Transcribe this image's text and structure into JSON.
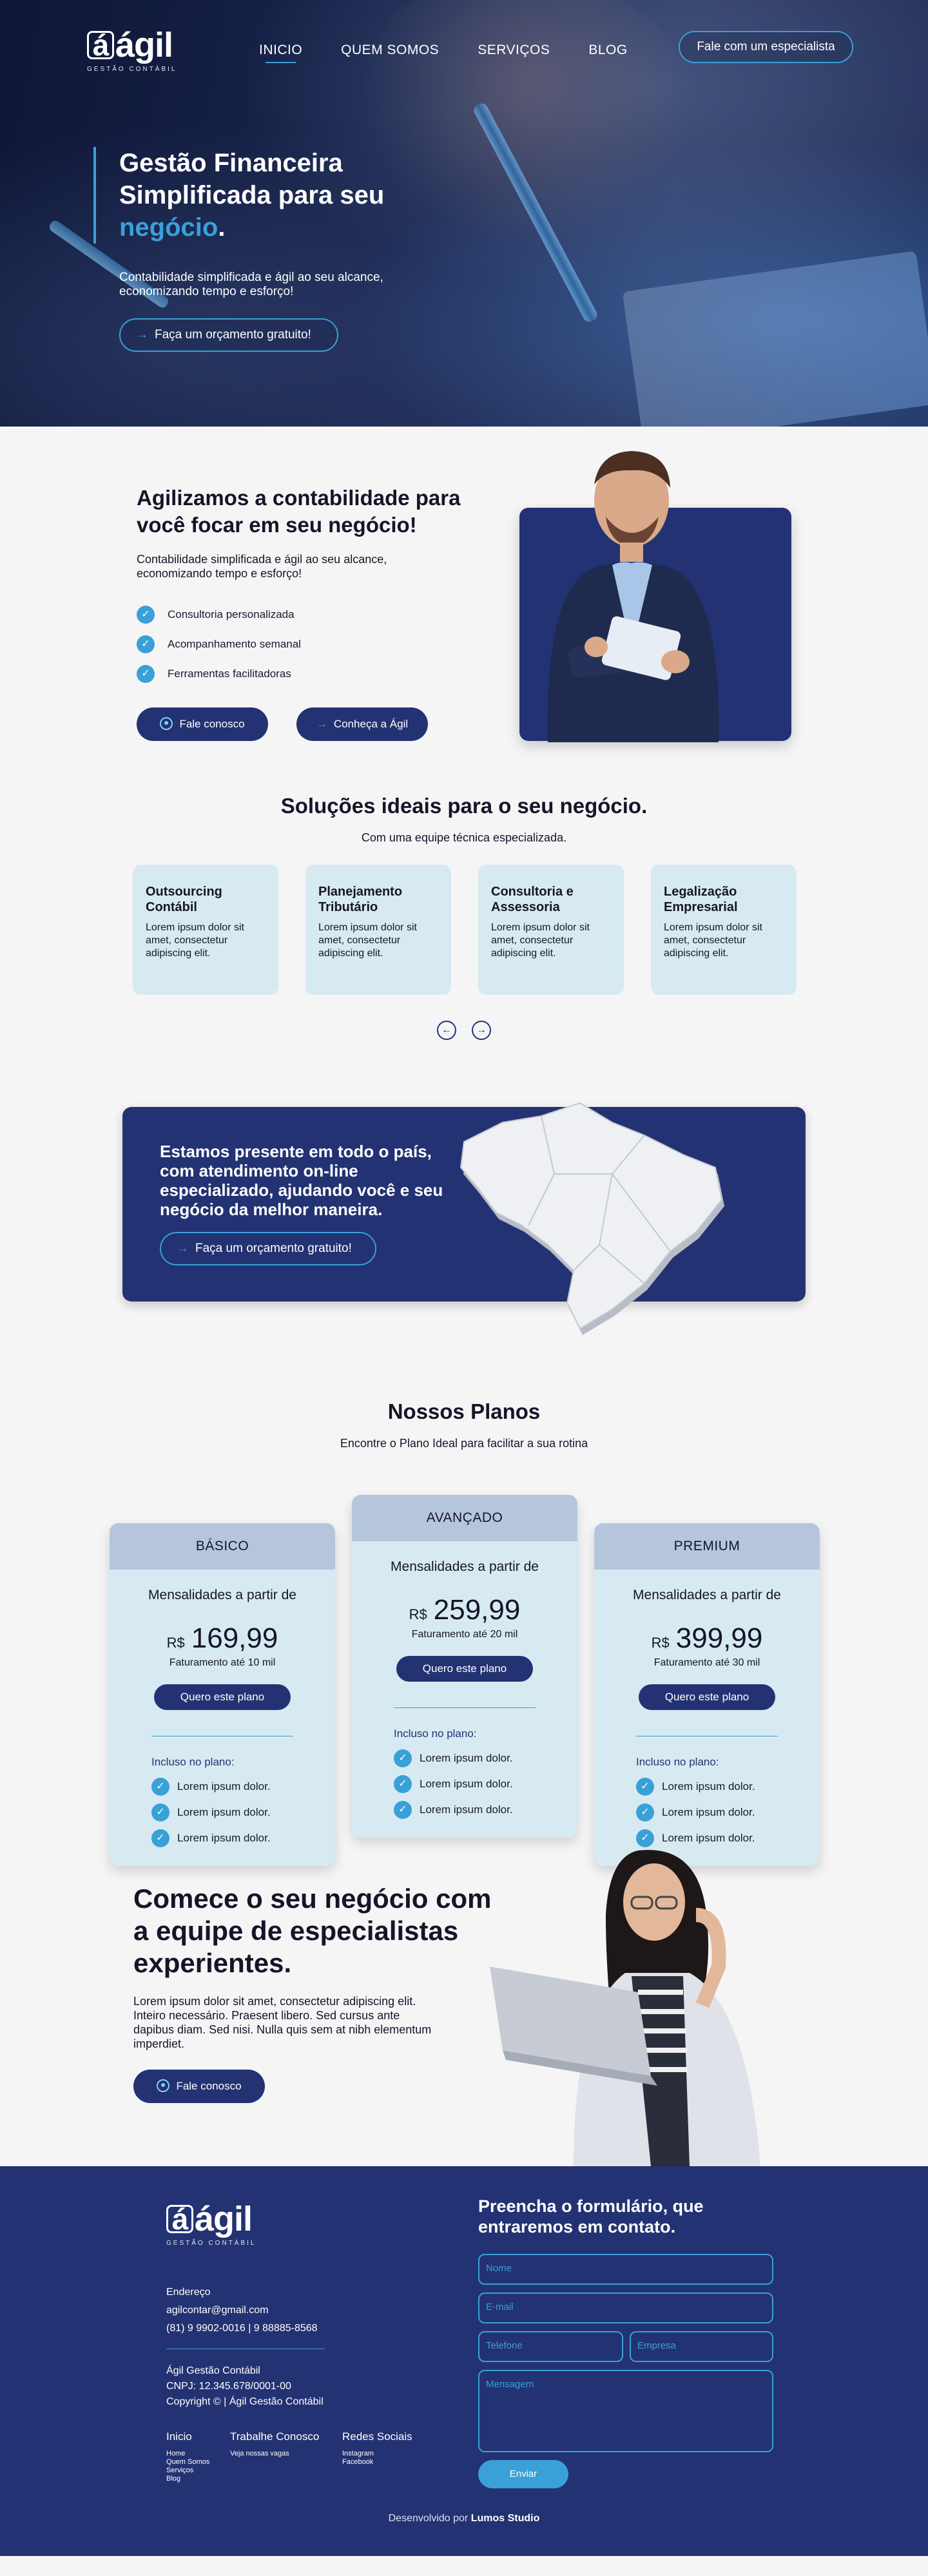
{
  "header": {
    "logo_text": "ágil",
    "logo_sub": "GESTÃO CONTÁBIL",
    "menu": [
      "INICIO",
      "QUEM SOMOS",
      "SERVIÇOS",
      "BLOG"
    ],
    "cta": "Fale com um especialista"
  },
  "hero": {
    "title_line1": "Gestão Financeira",
    "title_line2": "Simplificada para seu",
    "title_highlight": "negócio",
    "title_end": ".",
    "subtitle": "Contabilidade simplificada e ágil ao seu alcance, economizando tempo e esforço!",
    "button": "Faça um orçamento gratuito!"
  },
  "about": {
    "title": "Agilizamos a contabilidade para você focar em seu negócio!",
    "subtitle": "Contabilidade simplificada e ágil ao seu alcance, economizando tempo e esforço!",
    "checks": [
      "Consultoria personalizada",
      "Acompanhamento semanal",
      "Ferramentas facilitadoras"
    ],
    "btn_contact": "Fale conosco",
    "btn_know": "Conheça a Ágil"
  },
  "solutions": {
    "title": "Soluções ideais para o seu negócio.",
    "subtitle": "Com uma equipe técnica especializada.",
    "cards": [
      {
        "title": "Outsourcing Contábil",
        "text": "Lorem ipsum dolor sit amet, consectetur adipiscing elit."
      },
      {
        "title": "Planejamento Tributário",
        "text": "Lorem ipsum dolor sit amet, consectetur adipiscing elit."
      },
      {
        "title": "Consultoria e Assessoria",
        "text": "Lorem ipsum dolor sit amet, consectetur adipiscing elit."
      },
      {
        "title": "Legalização Empresarial",
        "text": "Lorem ipsum dolor sit amet, consectetur adipiscing elit."
      }
    ]
  },
  "banner": {
    "text": "Estamos presente em todo o país, com atendimento on-line especializado, ajudando você e seu negócio da melhor maneira.",
    "button": "Faça um orçamento gratuito!"
  },
  "plans": {
    "title": "Nossos Planos",
    "subtitle": "Encontre o Plano Ideal para facilitar a sua rotina",
    "items": [
      {
        "name": "BÁSICO",
        "from": "Mensalidades a partir de",
        "currency": "R$",
        "price": "169,99",
        "limit": "Faturamento até 10 mil",
        "button": "Quero este plano",
        "included": "Incluso no plano:",
        "features": [
          "Lorem ipsum dolor.",
          "Lorem ipsum dolor.",
          "Lorem ipsum dolor."
        ]
      },
      {
        "name": "AVANÇADO",
        "from": "Mensalidades a partir de",
        "currency": "R$",
        "price": "259,99",
        "limit": "Faturamento até 20 mil",
        "button": "Quero este plano",
        "included": "Incluso no plano:",
        "features": [
          "Lorem ipsum dolor.",
          "Lorem ipsum dolor.",
          "Lorem ipsum dolor."
        ]
      },
      {
        "name": "PREMIUM",
        "from": "Mensalidades a partir de",
        "currency": "R$",
        "price": "399,99",
        "limit": "Faturamento até 30 mil",
        "button": "Quero este plano",
        "included": "Incluso no plano:",
        "features": [
          "Lorem ipsum dolor.",
          "Lorem ipsum dolor.",
          "Lorem ipsum dolor."
        ]
      }
    ]
  },
  "start": {
    "title": "Comece o seu negócio com a equipe de especialistas experientes.",
    "text": "Lorem ipsum dolor sit amet, consectetur adipiscing elit. Inteiro necessário. Praesent libero. Sed cursus ante dapibus diam. Sed nisi. Nulla quis sem at nibh elementum imperdiet.",
    "button": "Fale conosco"
  },
  "footer": {
    "address_label": "Endereço",
    "email": "agilcontar@gmail.com",
    "phones": "(81) 9 9902-0016 | 9 88885-8568",
    "company": "Ágil Gestão Contábil",
    "cnpj": "CNPJ: 12.345.678/0001-00",
    "copyright": "Copyright © | Ágil Gestão Contábil",
    "col1_head": "Inicio",
    "col1_items": [
      "Home",
      "Quem Somos",
      "Serviços",
      "Blog"
    ],
    "col2_head": "Trabalhe Conosco",
    "col2_items": [
      "Veja nossas vagas"
    ],
    "col3_head": "Redes Sociais",
    "col3_items": [
      "Instagram",
      "Facebook"
    ],
    "form_title": "Preencha o formulário, que entraremos em contato.",
    "ph_name": "Nome",
    "ph_email": "E-mail",
    "ph_phone": "Telefone",
    "ph_company": "Empresa",
    "ph_message": "Mensagem",
    "send": "Enviar",
    "dev_prefix": "Desenvolvido por",
    "dev_name": "Lumos Studio"
  },
  "colors": {
    "navy": "#233272",
    "accent": "#3aa0d8",
    "card": "#d7eaf2",
    "plan_head": "#b5c6dc"
  }
}
